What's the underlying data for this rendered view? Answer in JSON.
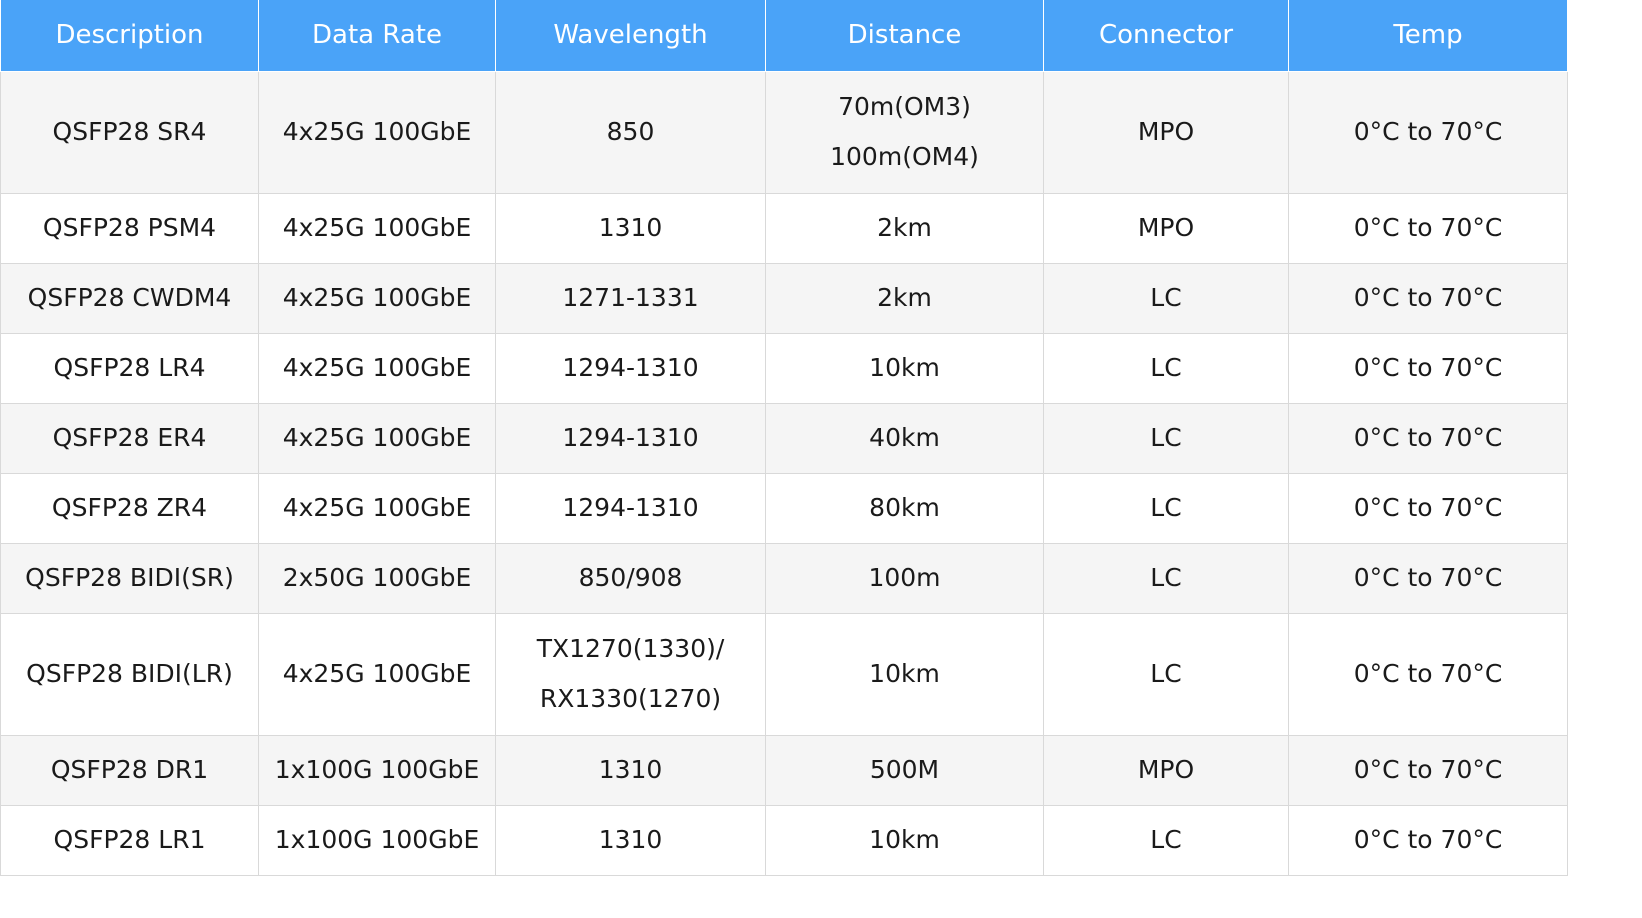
{
  "table": {
    "headers": [
      "Description",
      "Data Rate",
      "Wavelength",
      "Distance",
      "Connector",
      "Temp"
    ],
    "rows": [
      {
        "description": "QSFP28 SR4",
        "data_rate": "4x25G 100GbE",
        "wavelength": [
          "850"
        ],
        "distance": [
          "70m(OM3)",
          "100m(OM4)"
        ],
        "connector": "MPO",
        "temp": "0°C to 70°C"
      },
      {
        "description": "QSFP28 PSM4",
        "data_rate": "4x25G 100GbE",
        "wavelength": [
          "1310"
        ],
        "distance": [
          "2km"
        ],
        "connector": "MPO",
        "temp": "0°C to 70°C"
      },
      {
        "description": "QSFP28 CWDM4",
        "data_rate": "4x25G 100GbE",
        "wavelength": [
          "1271-1331"
        ],
        "distance": [
          "2km"
        ],
        "connector": "LC",
        "temp": "0°C to 70°C"
      },
      {
        "description": "QSFP28 LR4",
        "data_rate": "4x25G 100GbE",
        "wavelength": [
          "1294-1310"
        ],
        "distance": [
          "10km"
        ],
        "connector": "LC",
        "temp": "0°C to 70°C"
      },
      {
        "description": "QSFP28 ER4",
        "data_rate": "4x25G 100GbE",
        "wavelength": [
          "1294-1310"
        ],
        "distance": [
          "40km"
        ],
        "connector": "LC",
        "temp": "0°C to 70°C"
      },
      {
        "description": "QSFP28 ZR4",
        "data_rate": "4x25G 100GbE",
        "wavelength": [
          "1294-1310"
        ],
        "distance": [
          "80km"
        ],
        "connector": "LC",
        "temp": "0°C to 70°C"
      },
      {
        "description": "QSFP28 BIDI(SR)",
        "data_rate": "2x50G 100GbE",
        "wavelength": [
          "850/908"
        ],
        "distance": [
          "100m"
        ],
        "connector": "LC",
        "temp": "0°C to 70°C"
      },
      {
        "description": "QSFP28 BIDI(LR)",
        "data_rate": "4x25G 100GbE",
        "wavelength": [
          "TX1270(1330)/",
          "RX1330(1270)"
        ],
        "distance": [
          "10km"
        ],
        "connector": "LC",
        "temp": "0°C to 70°C"
      },
      {
        "description": "QSFP28 DR1",
        "data_rate": "1x100G 100GbE",
        "wavelength": [
          "1310"
        ],
        "distance": [
          "500M"
        ],
        "connector": "MPO",
        "temp": "0°C to 70°C"
      },
      {
        "description": "QSFP28 LR1",
        "data_rate": "1x100G 100GbE",
        "wavelength": [
          "1310"
        ],
        "distance": [
          "10km"
        ],
        "connector": "LC",
        "temp": "0°C to 70°C"
      }
    ]
  },
  "colors": {
    "header_bg": "#4aa3f8",
    "header_text": "#ffffff",
    "row_alt_bg": "#f5f5f5",
    "border": "#d9d9d9"
  }
}
